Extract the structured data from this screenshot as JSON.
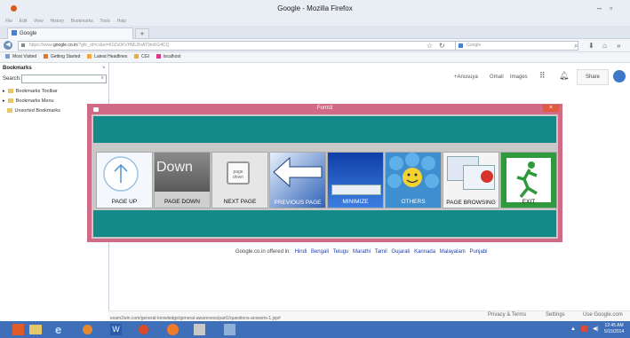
{
  "window": {
    "title": "Google - Mozilla Firefox",
    "controls": {
      "minimize": "–",
      "maximize": "▫"
    }
  },
  "menu": [
    "File",
    "Edit",
    "View",
    "History",
    "Bookmarks",
    "Tools",
    "Help"
  ],
  "tab": {
    "label": "Google",
    "new_tab": "+"
  },
  "nav": {
    "url_prefix": "https://www.",
    "url_domain": "google.co.in",
    "url_rest": "/?gfe_rd=cr&ei=K0Zs0KVHMLBvAT9mKG4CQ",
    "search_placeholder": "Google"
  },
  "bookmarks_toolbar": [
    "Most Visited",
    "Getting Started",
    "Latest Headlines",
    "CGI",
    "localhost"
  ],
  "sidebar": {
    "title": "Bookmarks",
    "close": "×",
    "search_label": "Search:",
    "items": [
      "Bookmarks Toolbar",
      "Bookmarks Menu",
      "Unsorted Bookmarks"
    ]
  },
  "google": {
    "top_links": [
      "+Anusuya",
      "Gmail",
      "Images"
    ],
    "share": "Share",
    "offered_in": "Google.co.in offered in:",
    "languages": [
      "Hindi",
      "Bengali",
      "Telugu",
      "Marathi",
      "Tamil",
      "Gujarati",
      "Kannada",
      "Malayalam",
      "Punjabi"
    ],
    "footer_links": [
      "Privacy & Terms",
      "Settings",
      "Use Google.com"
    ]
  },
  "status_url": "exam2win.com/general-knowledge/general-awareness/part1/questions-answers-1.jsp#",
  "form": {
    "title": "Form3",
    "close": "×",
    "buttons": [
      {
        "label": "PAGE UP",
        "image_text": ""
      },
      {
        "label": "PAGE DOWN",
        "image_text": "Down"
      },
      {
        "label": "NEXT PAGE",
        "image_text": "page down"
      },
      {
        "label": "PREVIOUS PAGE",
        "image_text": ""
      },
      {
        "label": "MINIMIZE",
        "image_text": ""
      },
      {
        "label": "OTHERS",
        "image_text": ""
      },
      {
        "label": "PAGE BROWSING",
        "image_text": ""
      },
      {
        "label": "EXIT",
        "image_text": ""
      }
    ]
  },
  "taskbar": {
    "clock_time": "12:45 AM",
    "clock_date": "5/15/2014"
  },
  "colors": {
    "form_border": "#d16a86",
    "form_teal": "#138a87",
    "taskbar": "#3f6fb8"
  }
}
